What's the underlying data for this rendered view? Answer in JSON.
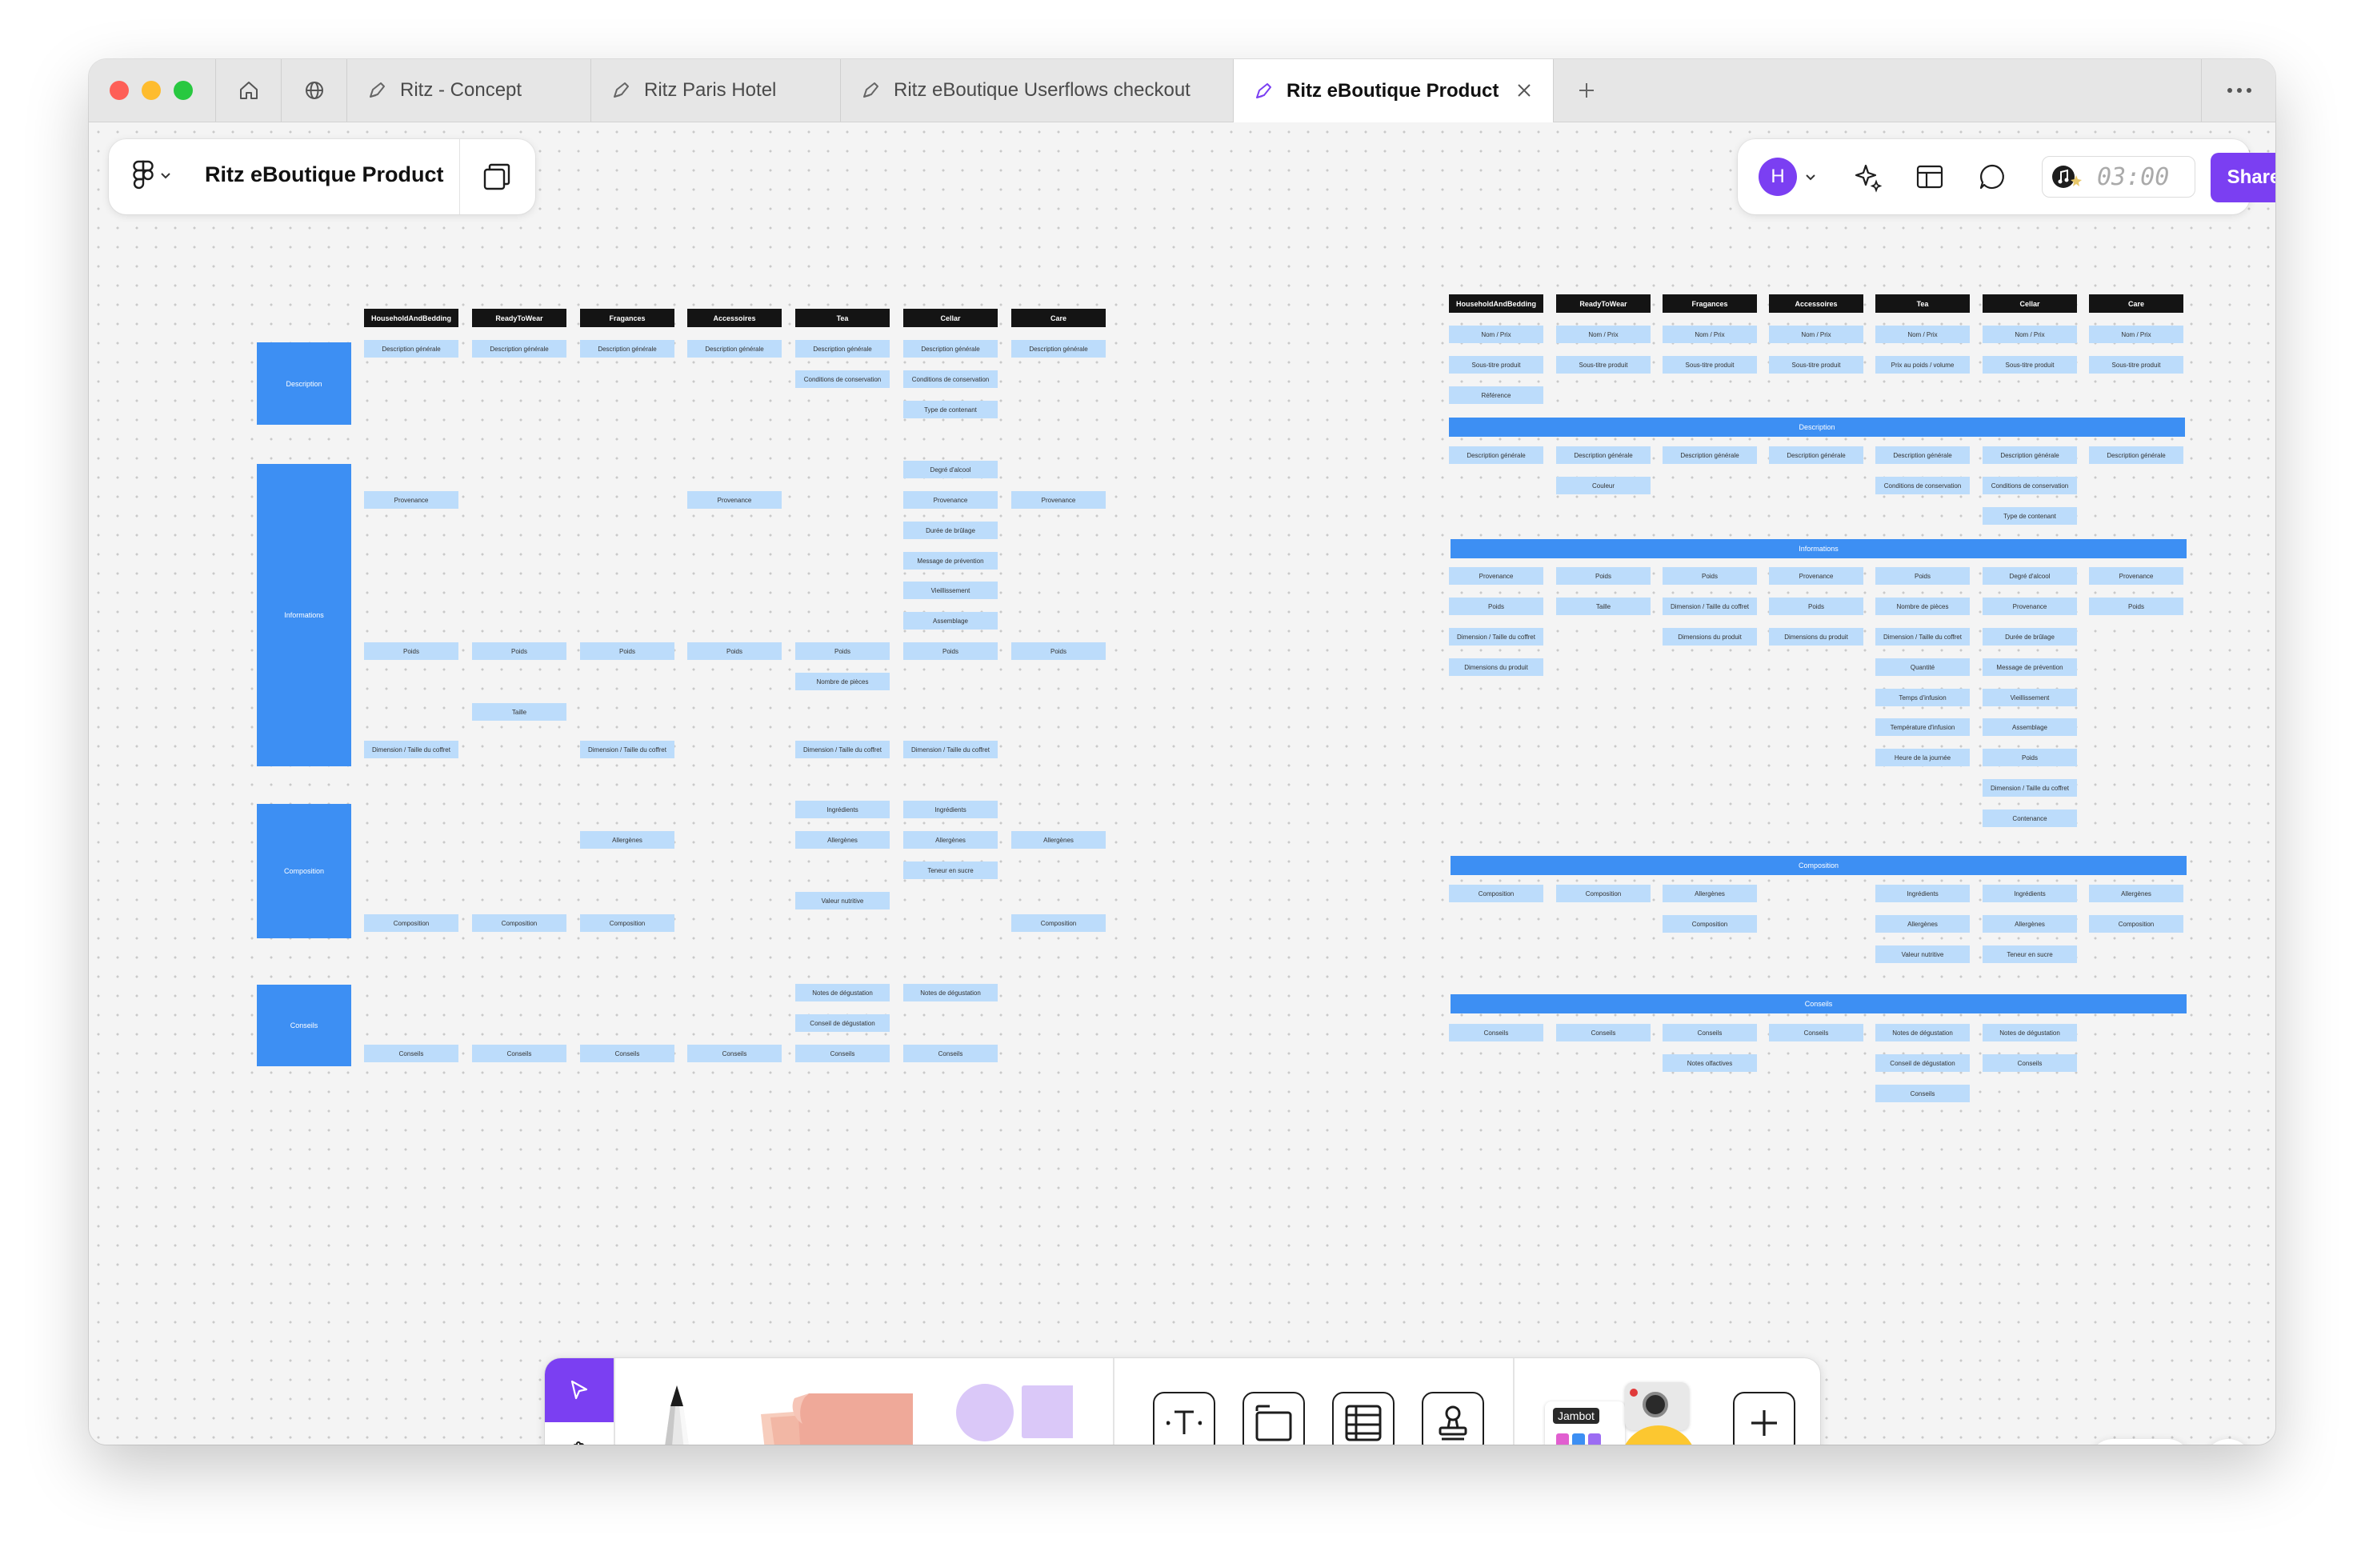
{
  "tabs": [
    {
      "label": "Ritz - Concept"
    },
    {
      "label": "Ritz Paris Hotel"
    },
    {
      "label": "Ritz eBoutique Userflows checkout"
    },
    {
      "label": "Ritz eBoutique Product"
    }
  ],
  "file": {
    "title": "Ritz eBoutique Product"
  },
  "topbar": {
    "avatar_initial": "H",
    "timer": "03:00",
    "share_label": "Share"
  },
  "colors": {
    "accent": "#7b3ff2",
    "section_blue": "#3d8ff3",
    "cell_blue": "#bcdcfb",
    "header_black": "#141414"
  },
  "board_left": {
    "columns": [
      "HouseholdAndBedding",
      "ReadyToWear",
      "Fragances",
      "Accessoires",
      "Tea",
      "Cellar",
      "Care"
    ],
    "sections": [
      "Description",
      "Informations",
      "Composition",
      "Conseils"
    ],
    "cells": [
      {
        "col": 0,
        "row": 0,
        "text": "Description générale"
      },
      {
        "col": 1,
        "row": 0,
        "text": "Description générale"
      },
      {
        "col": 2,
        "row": 0,
        "text": "Description générale"
      },
      {
        "col": 3,
        "row": 0,
        "text": "Description générale"
      },
      {
        "col": 4,
        "row": 0,
        "text": "Description générale"
      },
      {
        "col": 5,
        "row": 0,
        "text": "Description générale"
      },
      {
        "col": 6,
        "row": 0,
        "text": "Description générale"
      },
      {
        "col": 4,
        "row": 1,
        "text": "Conditions de conservation"
      },
      {
        "col": 5,
        "row": 1,
        "text": "Conditions de conservation"
      },
      {
        "col": 5,
        "row": 2,
        "text": "Type de contenant"
      },
      {
        "col": 5,
        "row": 4,
        "text": "Degré d'alcool"
      },
      {
        "col": 0,
        "row": 5,
        "text": "Provenance"
      },
      {
        "col": 3,
        "row": 5,
        "text": "Provenance"
      },
      {
        "col": 5,
        "row": 5,
        "text": "Provenance"
      },
      {
        "col": 6,
        "row": 5,
        "text": "Provenance"
      },
      {
        "col": 5,
        "row": 6,
        "text": "Durée de brûlage"
      },
      {
        "col": 5,
        "row": 7,
        "text": "Message de prévention"
      },
      {
        "col": 5,
        "row": 8,
        "text": "Vieillissement"
      },
      {
        "col": 5,
        "row": 9,
        "text": "Assemblage"
      },
      {
        "col": 0,
        "row": 10,
        "text": "Poids"
      },
      {
        "col": 1,
        "row": 10,
        "text": "Poids"
      },
      {
        "col": 2,
        "row": 10,
        "text": "Poids"
      },
      {
        "col": 3,
        "row": 10,
        "text": "Poids"
      },
      {
        "col": 4,
        "row": 10,
        "text": "Poids"
      },
      {
        "col": 5,
        "row": 10,
        "text": "Poids"
      },
      {
        "col": 6,
        "row": 10,
        "text": "Poids"
      },
      {
        "col": 4,
        "row": 11,
        "text": "Nombre de pièces"
      },
      {
        "col": 1,
        "row": 12,
        "text": "Taille"
      },
      {
        "col": 0,
        "row": 13.25,
        "text": "Dimension / Taille du coffret"
      },
      {
        "col": 2,
        "row": 13.25,
        "text": "Dimension / Taille du coffret"
      },
      {
        "col": 4,
        "row": 13.25,
        "text": "Dimension / Taille du coffret"
      },
      {
        "col": 5,
        "row": 13.25,
        "text": "Dimension / Taille du coffret"
      },
      {
        "col": 4,
        "row": 15.25,
        "text": "Ingrédients"
      },
      {
        "col": 5,
        "row": 15.25,
        "text": "Ingrédients"
      },
      {
        "col": 2,
        "row": 16.25,
        "text": "Allergènes"
      },
      {
        "col": 4,
        "row": 16.25,
        "text": "Allergènes"
      },
      {
        "col": 5,
        "row": 16.25,
        "text": "Allergènes"
      },
      {
        "col": 6,
        "row": 16.25,
        "text": "Allergènes"
      },
      {
        "col": 5,
        "row": 17.25,
        "text": "Teneur en sucre"
      },
      {
        "col": 4,
        "row": 18.25,
        "text": "Valeur nutritive"
      },
      {
        "col": 0,
        "row": 19,
        "text": "Composition"
      },
      {
        "col": 1,
        "row": 19,
        "text": "Composition"
      },
      {
        "col": 2,
        "row": 19,
        "text": "Composition"
      },
      {
        "col": 6,
        "row": 19,
        "text": "Composition"
      },
      {
        "col": 4,
        "row": 21.3,
        "text": "Notes de dégustation"
      },
      {
        "col": 5,
        "row": 21.3,
        "text": "Notes de dégustation"
      },
      {
        "col": 4,
        "row": 22.3,
        "text": "Conseil de dégustation"
      },
      {
        "col": 0,
        "row": 23.3,
        "text": "Conseils"
      },
      {
        "col": 1,
        "row": 23.3,
        "text": "Conseils"
      },
      {
        "col": 2,
        "row": 23.3,
        "text": "Conseils"
      },
      {
        "col": 3,
        "row": 23.3,
        "text": "Conseils"
      },
      {
        "col": 4,
        "row": 23.3,
        "text": "Conseils"
      },
      {
        "col": 5,
        "row": 23.3,
        "text": "Conseils"
      }
    ]
  },
  "board_right": {
    "columns": [
      "HouseholdAndBedding",
      "ReadyToWear",
      "Fragances",
      "Accessoires",
      "Tea",
      "Cellar",
      "Care"
    ],
    "sections": [
      "Description",
      "Informations",
      "Composition",
      "Conseils"
    ],
    "cells": [
      {
        "col": 0,
        "row": 0,
        "text": "Nom / Prix"
      },
      {
        "col": 1,
        "row": 0,
        "text": "Nom / Prix"
      },
      {
        "col": 2,
        "row": 0,
        "text": "Nom / Prix"
      },
      {
        "col": 3,
        "row": 0,
        "text": "Nom / Prix"
      },
      {
        "col": 4,
        "row": 0,
        "text": "Nom / Prix"
      },
      {
        "col": 5,
        "row": 0,
        "text": "Nom / Prix"
      },
      {
        "col": 6,
        "row": 0,
        "text": "Nom / Prix"
      },
      {
        "col": 0,
        "row": 1,
        "text": "Sous-titre produit"
      },
      {
        "col": 1,
        "row": 1,
        "text": "Sous-titre produit"
      },
      {
        "col": 2,
        "row": 1,
        "text": "Sous-titre produit"
      },
      {
        "col": 3,
        "row": 1,
        "text": "Sous-titre produit"
      },
      {
        "col": 4,
        "row": 1,
        "text": "Prix au poids / volume"
      },
      {
        "col": 5,
        "row": 1,
        "text": "Sous-titre produit"
      },
      {
        "col": 6,
        "row": 1,
        "text": "Sous-titre produit"
      },
      {
        "col": 0,
        "row": 2,
        "text": "Référence"
      },
      {
        "col": 0,
        "row": 4,
        "text": "Description générale"
      },
      {
        "col": 1,
        "row": 4,
        "text": "Description générale"
      },
      {
        "col": 2,
        "row": 4,
        "text": "Description générale"
      },
      {
        "col": 3,
        "row": 4,
        "text": "Description générale"
      },
      {
        "col": 4,
        "row": 4,
        "text": "Description générale"
      },
      {
        "col": 5,
        "row": 4,
        "text": "Description générale"
      },
      {
        "col": 6,
        "row": 4,
        "text": "Description générale"
      },
      {
        "col": 1,
        "row": 5,
        "text": "Couleur"
      },
      {
        "col": 4,
        "row": 5,
        "text": "Conditions de conservation"
      },
      {
        "col": 5,
        "row": 5,
        "text": "Conditions de conservation"
      },
      {
        "col": 5,
        "row": 6,
        "text": "Type de contenant"
      },
      {
        "col": 0,
        "row": 8,
        "text": "Provenance"
      },
      {
        "col": 1,
        "row": 8,
        "text": "Poids"
      },
      {
        "col": 2,
        "row": 8,
        "text": "Poids"
      },
      {
        "col": 3,
        "row": 8,
        "text": "Provenance"
      },
      {
        "col": 4,
        "row": 8,
        "text": "Poids"
      },
      {
        "col": 5,
        "row": 8,
        "text": "Degré d'alcool"
      },
      {
        "col": 6,
        "row": 8,
        "text": "Provenance"
      },
      {
        "col": 0,
        "row": 9,
        "text": "Poids"
      },
      {
        "col": 1,
        "row": 9,
        "text": "Taille"
      },
      {
        "col": 2,
        "row": 9,
        "text": "Dimension / Taille du coffret"
      },
      {
        "col": 3,
        "row": 9,
        "text": "Poids"
      },
      {
        "col": 4,
        "row": 9,
        "text": "Nombre de pièces"
      },
      {
        "col": 5,
        "row": 9,
        "text": "Provenance"
      },
      {
        "col": 6,
        "row": 9,
        "text": "Poids"
      },
      {
        "col": 0,
        "row": 10,
        "text": "Dimension / Taille du coffret"
      },
      {
        "col": 2,
        "row": 10,
        "text": "Dimensions du produit"
      },
      {
        "col": 3,
        "row": 10,
        "text": "Dimensions du produit"
      },
      {
        "col": 4,
        "row": 10,
        "text": "Dimension / Taille du coffret"
      },
      {
        "col": 5,
        "row": 10,
        "text": "Durée de brûlage"
      },
      {
        "col": 0,
        "row": 11,
        "text": "Dimensions du produit"
      },
      {
        "col": 4,
        "row": 11,
        "text": "Quantité"
      },
      {
        "col": 5,
        "row": 11,
        "text": "Message de prévention"
      },
      {
        "col": 4,
        "row": 12,
        "text": "Temps d'infusion"
      },
      {
        "col": 5,
        "row": 12,
        "text": "Vieillissement"
      },
      {
        "col": 4,
        "row": 13,
        "text": "Température d'infusion"
      },
      {
        "col": 5,
        "row": 13,
        "text": "Assemblage"
      },
      {
        "col": 4,
        "row": 14,
        "text": "Heure de la journée"
      },
      {
        "col": 5,
        "row": 14,
        "text": "Poids"
      },
      {
        "col": 5,
        "row": 15,
        "text": "Dimension / Taille du coffret"
      },
      {
        "col": 5,
        "row": 16,
        "text": "Contenance"
      },
      {
        "col": 0,
        "row": 18.5,
        "text": "Composition"
      },
      {
        "col": 1,
        "row": 18.5,
        "text": "Composition"
      },
      {
        "col": 2,
        "row": 18.5,
        "text": "Allergènes"
      },
      {
        "col": 4,
        "row": 18.5,
        "text": "Ingrédients"
      },
      {
        "col": 5,
        "row": 18.5,
        "text": "Ingrédients"
      },
      {
        "col": 6,
        "row": 18.5,
        "text": "Allergènes"
      },
      {
        "col": 2,
        "row": 19.5,
        "text": "Composition"
      },
      {
        "col": 4,
        "row": 19.5,
        "text": "Allergènes"
      },
      {
        "col": 5,
        "row": 19.5,
        "text": "Allergènes"
      },
      {
        "col": 6,
        "row": 19.5,
        "text": "Composition"
      },
      {
        "col": 4,
        "row": 20.5,
        "text": "Valeur nutritive"
      },
      {
        "col": 5,
        "row": 20.5,
        "text": "Teneur en sucre"
      },
      {
        "col": 0,
        "row": 23.1,
        "text": "Conseils"
      },
      {
        "col": 1,
        "row": 23.1,
        "text": "Conseils"
      },
      {
        "col": 2,
        "row": 23.1,
        "text": "Conseils"
      },
      {
        "col": 3,
        "row": 23.1,
        "text": "Conseils"
      },
      {
        "col": 4,
        "row": 23.1,
        "text": "Notes de dégustation"
      },
      {
        "col": 5,
        "row": 23.1,
        "text": "Notes de dégustation"
      },
      {
        "col": 2,
        "row": 24.1,
        "text": "Notes olfactives"
      },
      {
        "col": 4,
        "row": 24.1,
        "text": "Conseil de dégustation"
      },
      {
        "col": 5,
        "row": 24.1,
        "text": "Conseils"
      },
      {
        "col": 4,
        "row": 25.1,
        "text": "Conseils"
      }
    ]
  },
  "toolbar": {
    "tools": [
      "move-tool",
      "hand-tool",
      "marker-tool",
      "sticky-note-tool",
      "shape-tool",
      "text-tool",
      "section-tool",
      "table-tool",
      "stamp-tool",
      "widgets-tool",
      "more-tool"
    ],
    "jambot_label": "Jambot"
  },
  "zoom": {
    "minus": "−",
    "plus": "+",
    "help": "?"
  }
}
